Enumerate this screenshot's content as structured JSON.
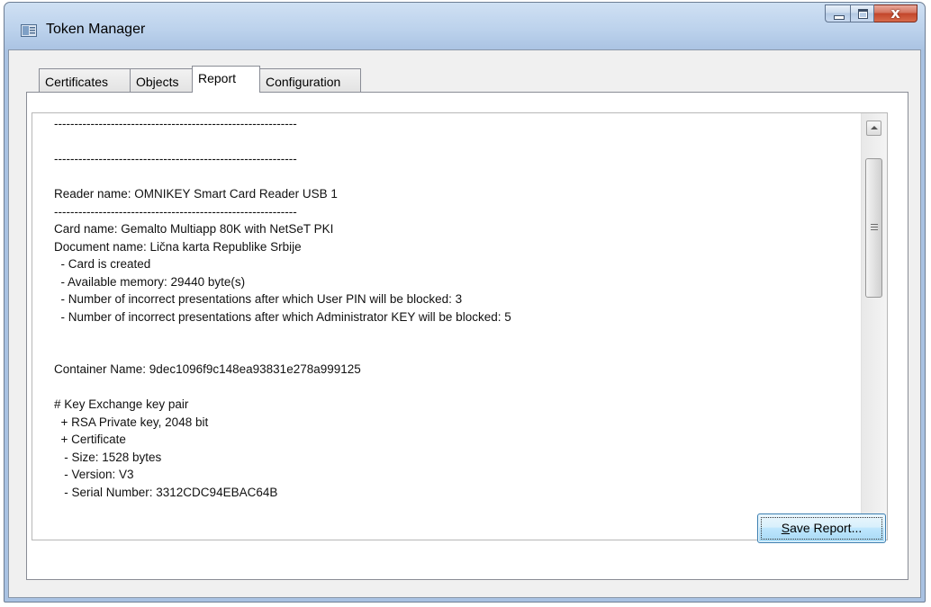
{
  "window": {
    "title": "Token Manager",
    "close_glyph": "x"
  },
  "tabs": [
    {
      "label": "Certificates"
    },
    {
      "label": "Objects"
    },
    {
      "label": "Report"
    },
    {
      "label": "Configuration"
    }
  ],
  "active_tab": "Report",
  "report": {
    "lines": [
      "------------------------------------------------------------",
      "",
      "------------------------------------------------------------",
      "",
      "Reader name: OMNIKEY Smart Card Reader USB 1",
      "------------------------------------------------------------",
      "Card name: Gemalto Multiapp 80K with NetSeT PKI",
      "Document name: Lična karta Republike Srbije",
      "  - Card is created",
      "  - Available memory: 29440 byte(s)",
      "  - Number of incorrect presentations after which User PIN will be blocked: 3",
      "  - Number of incorrect presentations after which Administrator KEY will be blocked: 5",
      "",
      "",
      "Container Name: 9dec1096f9c148ea93831e278a999125",
      "",
      "# Key Exchange key pair",
      "  + RSA Private key, 2048 bit",
      "  + Certificate",
      "   - Size: 1528 bytes",
      "   - Version: V3",
      "   - Serial Number: 3312CDC94EBAC64B"
    ]
  },
  "buttons": {
    "save_report": "Save Report..."
  },
  "colors": {
    "frame": "#a9c2e2",
    "close_button": "#c2452a",
    "default_button_border": "#3c7fb1"
  }
}
